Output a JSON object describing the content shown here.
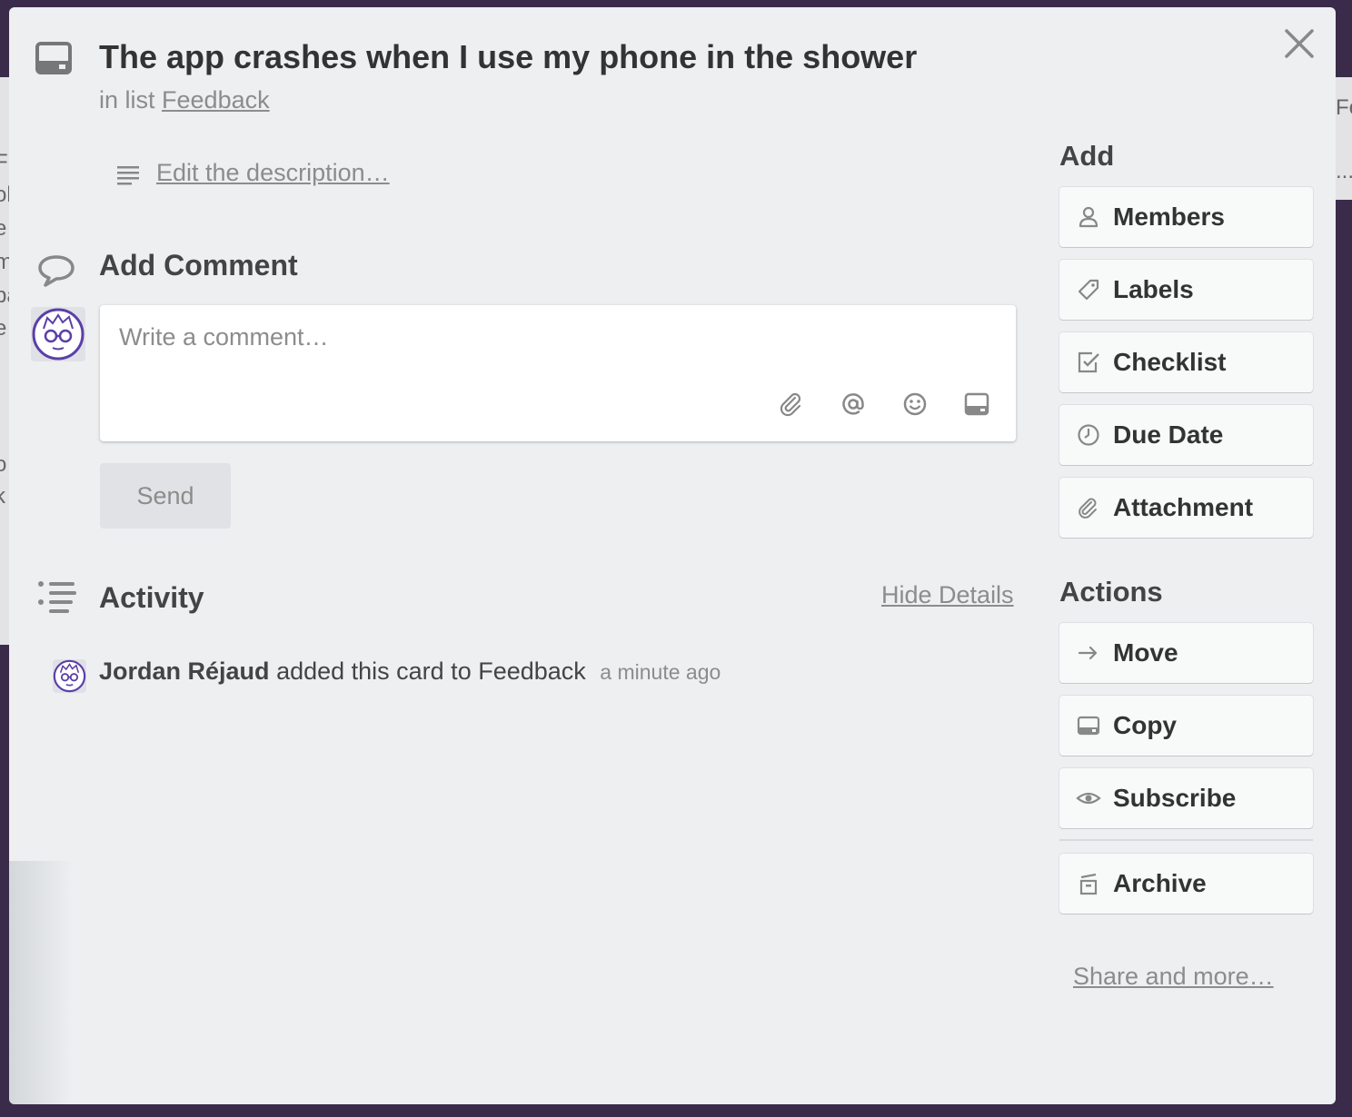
{
  "background": {
    "left_fragments": [
      "F",
      "ol",
      "e",
      "m",
      "pa",
      "e",
      "o",
      "k"
    ],
    "right_fragments": [
      "Fe",
      "..."
    ]
  },
  "card": {
    "title": "The app crashes when I use my phone in the shower",
    "in_list_prefix": "in list",
    "list_name": "Feedback",
    "edit_description": "Edit the description…",
    "icon": "card-icon"
  },
  "comment": {
    "heading": "Add Comment",
    "placeholder": "Write a comment…",
    "tools": [
      "paperclip-icon",
      "mention-icon",
      "emoji-icon",
      "card-icon"
    ],
    "send_label": "Send"
  },
  "activity": {
    "heading": "Activity",
    "hide_details": "Hide Details",
    "entries": [
      {
        "user": "Jordan Réjaud",
        "text": "added this card to Feedback",
        "time": "a minute ago"
      }
    ]
  },
  "sidebar": {
    "add_heading": "Add",
    "add_buttons": [
      {
        "label": "Members",
        "icon": "person-icon"
      },
      {
        "label": "Labels",
        "icon": "tag-icon"
      },
      {
        "label": "Checklist",
        "icon": "checkbox-icon"
      },
      {
        "label": "Due Date",
        "icon": "clock-icon"
      },
      {
        "label": "Attachment",
        "icon": "paperclip-icon"
      }
    ],
    "actions_heading": "Actions",
    "action_buttons": [
      {
        "label": "Move",
        "icon": "arrow-right-icon"
      },
      {
        "label": "Copy",
        "icon": "card-icon"
      },
      {
        "label": "Subscribe",
        "icon": "eye-icon"
      },
      {
        "label": "Archive",
        "icon": "archive-icon"
      }
    ],
    "share_more": "Share and more…"
  },
  "colors": {
    "modal_bg": "#edeff1",
    "backdrop": "#3a2b4a",
    "avatar_accent": "#5b3fa8",
    "muted_text": "#8c8c8c"
  }
}
